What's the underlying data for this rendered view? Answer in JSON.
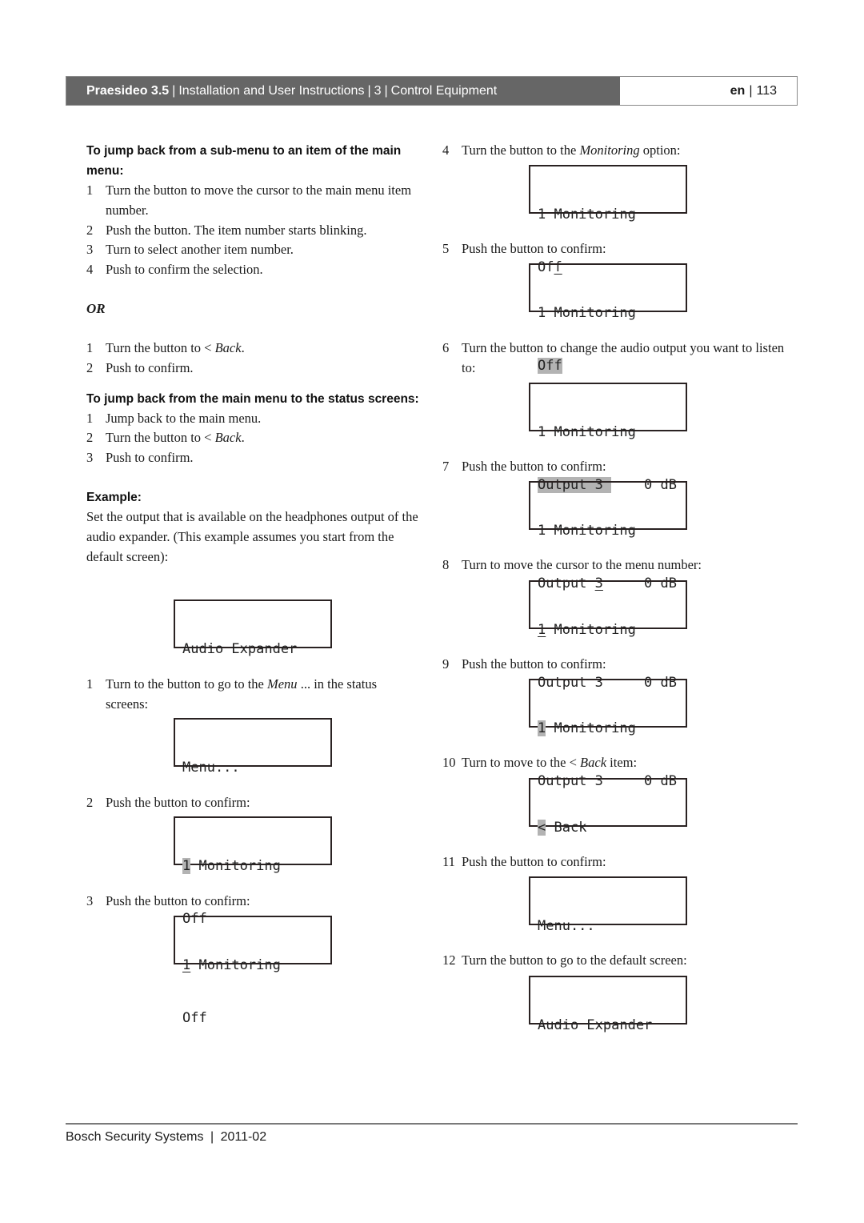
{
  "header": {
    "product": "Praesideo 3.5",
    "doc_title": "Installation and User Instructions",
    "chapter_number": "3",
    "chapter_title": "Control Equipment",
    "separator": "|",
    "language": "en",
    "page_number": "113",
    "colors": {
      "bar": "#666666",
      "bar_text": "#ffffff"
    }
  },
  "left": {
    "section1": {
      "heading": "To jump back from a sub-menu to an item of the main menu:",
      "steps": [
        {
          "num": "1",
          "text": "Turn the button to move the cursor to the main menu item number."
        },
        {
          "num": "2",
          "text": "Push the button. The item number starts blinking."
        },
        {
          "num": "3",
          "text": "Turn to select another item number."
        },
        {
          "num": "4",
          "text": "Push to confirm the selection."
        }
      ]
    },
    "or_label": "OR",
    "section1b": {
      "steps": [
        {
          "num": "1",
          "text_before": "Turn the button to < ",
          "text_italic": "Back",
          "text_after": "."
        },
        {
          "num": "2",
          "text": "Push to confirm."
        }
      ]
    },
    "section2": {
      "heading": "To jump back from the main menu to the status screens:",
      "steps": [
        {
          "num": "1",
          "text": "Jump back to the main menu."
        },
        {
          "num": "2",
          "text_before": "Turn the button to < ",
          "text_italic": "Back",
          "text_after": "."
        },
        {
          "num": "3",
          "text": "Push to confirm."
        }
      ]
    },
    "example": {
      "heading": "Example:",
      "intro": "Set the output that is available on the headphones output of the audio expander. (This example assumes you start from the default screen):",
      "default_screen": {
        "line1": "Audio Expander",
        "line2": ""
      },
      "steps": [
        {
          "num": "1",
          "text_before": "Turn to the button to go to the ",
          "text_italic": "Menu",
          "text_after": " ... in the status screens:",
          "screen": {
            "line1": "Menu...",
            "line2": ""
          }
        },
        {
          "num": "2",
          "text": "Push the button to confirm:",
          "screen": {
            "line1_hl": "1",
            "line1_rest": " Monitoring",
            "line2": "Off"
          }
        },
        {
          "num": "3",
          "text": "Push the button to confirm:",
          "screen": {
            "line1_ul": "1",
            "line1_rest": " Monitoring",
            "line2": "Off"
          }
        }
      ]
    }
  },
  "right": {
    "steps": [
      {
        "num": "4",
        "text_before": "Turn the button to the ",
        "text_italic": "Monitoring",
        "text_after": " option:",
        "screen": {
          "line1": "1 Monitoring",
          "line2_pre": "Of",
          "line2_ul": "f"
        }
      },
      {
        "num": "5",
        "text": "Push the button to confirm:",
        "screen": {
          "line1": "1 Monitoring",
          "line2_hl": "Off"
        }
      },
      {
        "num": "6",
        "text": "Turn the button to change the audio output you want to listen to:",
        "screen": {
          "line1": "1 Monitoring",
          "line2_hl": "Output 3 ",
          "level": "0 dB"
        }
      },
      {
        "num": "7",
        "text": "Push the button to confirm:",
        "screen": {
          "line1": "1 Monitoring",
          "line2_pre": "Output ",
          "line2_ul": "3",
          "level": "0 dB"
        }
      },
      {
        "num": "8",
        "text": "Turn to move the cursor to the menu number:",
        "screen": {
          "line1_ul": "1",
          "line1_rest": " Monitoring",
          "line2": "Output 3",
          "level": "0 dB"
        }
      },
      {
        "num": "9",
        "text": "Push the button to confirm:",
        "screen": {
          "line1_hl": "1",
          "line1_rest": " Monitoring",
          "line2": "Output 3",
          "level": "0 dB"
        }
      },
      {
        "num": "10",
        "text_before": "Turn to move to the < ",
        "text_italic": "Back",
        "text_after": " item:",
        "screen": {
          "line1_hl": "<",
          "line1_rest": " Back",
          "line2": ""
        }
      },
      {
        "num": "11",
        "text": "Push the button to confirm:",
        "screen": {
          "line1": "Menu...",
          "line2": ""
        }
      },
      {
        "num": "12",
        "text": "Turn the button to go to the default screen:",
        "screen": {
          "line1": "Audio Expander",
          "line2": ""
        }
      }
    ]
  },
  "footer": {
    "company": "Bosch Security Systems",
    "separator": "|",
    "date": "2011-02"
  }
}
